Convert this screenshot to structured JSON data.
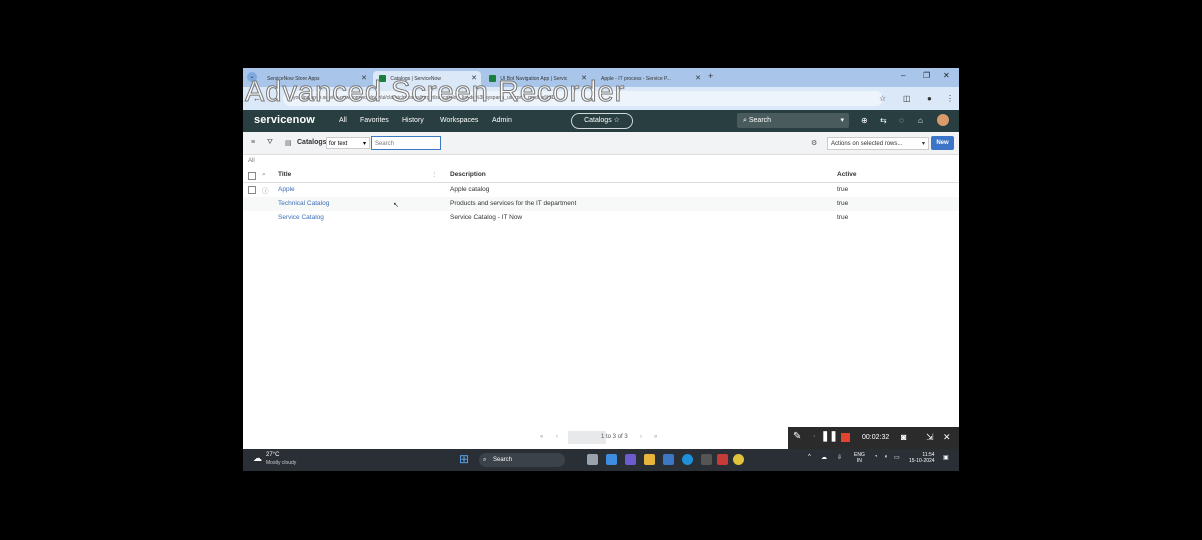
{
  "watermark": "Advanced Screen Recorder",
  "browser": {
    "tabs": [
      {
        "label": "ServiceNow Store Apps"
      },
      {
        "label": "Catalogs | ServiceNow"
      },
      {
        "label": "UI Bot Navigation App | Servic"
      },
      {
        "label": "Apple - IT process - Service P..."
      }
    ],
    "new_tab": "+",
    "url": "yourinstance.service-now.com/now/nav/ui/classic/params/target/sc_catalog_list.do%3Fsysparm_userpref_module%3D...",
    "window": {
      "minimize": "–",
      "restore": "❐",
      "close": "✕"
    }
  },
  "header": {
    "logo": "servicenow",
    "nav": [
      "All",
      "Favorites",
      "History",
      "Workspaces",
      "Admin"
    ],
    "context_pill": "Catalogs ☆",
    "search_placeholder": "Search"
  },
  "toolbar": {
    "list_title": "Catalogs",
    "filter_field": "for text",
    "search_placeholder": "Search",
    "actions_label": "Actions on selected rows...",
    "new_label": "New"
  },
  "breadcrumb": "All",
  "table": {
    "columns": [
      "Title",
      "Description",
      "Active"
    ],
    "rows": [
      {
        "title": "Apple",
        "description": "Apple catalog",
        "active": "true"
      },
      {
        "title": "Technical Catalog",
        "description": "Products and services for the IT department",
        "active": "true"
      },
      {
        "title": "Service Catalog",
        "description": "Service Catalog - IT Now",
        "active": "true"
      }
    ]
  },
  "pagination": {
    "summary": "1 to 3 of 3",
    "first": "«",
    "prev": "‹",
    "next": "›",
    "last": "»"
  },
  "recorder": {
    "time": "00:02:32"
  },
  "taskbar": {
    "weather_temp": "27°C",
    "weather_desc": "Mostly cloudy",
    "search_label": "Search",
    "lang_top": "ENG",
    "lang_bottom": "IN",
    "clock_time": "11:54",
    "clock_date": "15-10-2024"
  }
}
